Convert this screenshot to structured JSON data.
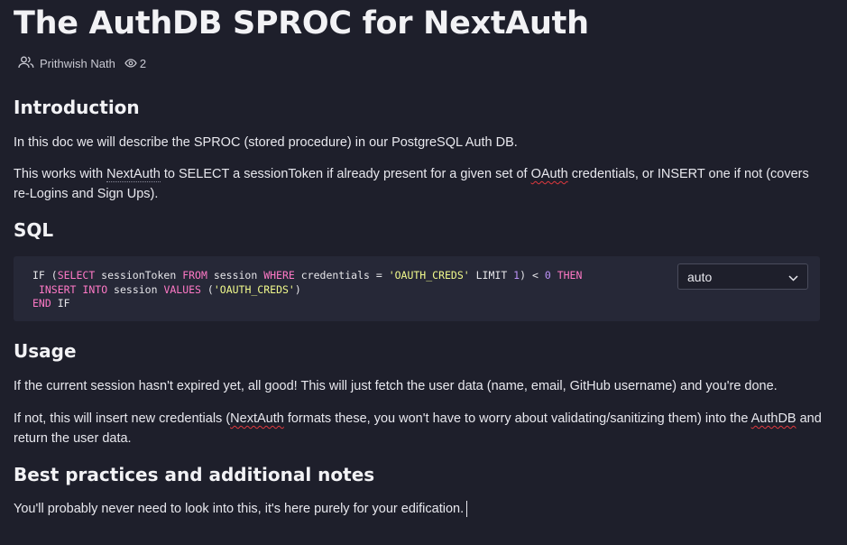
{
  "doc": {
    "title": "The AuthDB SPROC for NextAuth",
    "author": "Prithwish Nath",
    "views": "2"
  },
  "sections": {
    "intro_heading": "Introduction",
    "intro_p1": "In this doc we will describe the SPROC (stored procedure)  in our PostgreSQL Auth DB.",
    "intro_p2_a": "This works with ",
    "intro_p2_nextauth": "NextAuth",
    "intro_p2_b": " to SELECT a sessionToken if already present for a given set of ",
    "intro_p2_oauth": "OAuth",
    "intro_p2_c": " credentials, or INSERT one if not (covers re-Logins and Sign Ups).",
    "sql_heading": "SQL",
    "usage_heading": "Usage",
    "usage_p1": "If the current session hasn't expired yet, all good! This will just fetch the user data (name, email, GitHub username) and you're done.",
    "usage_p2_a": "If not, this will insert new credentials (",
    "usage_p2_nextauth": "NextAuth",
    "usage_p2_b": " formats these, you won't have to worry about validating/sanitizing them) into the ",
    "usage_p2_authdb": "AuthDB",
    "usage_p2_c": " and return the user data.",
    "best_heading": "Best practices and additional notes",
    "best_p1": "You'll probably never need to look into this, it's here purely for your edification."
  },
  "code": {
    "language": "auto",
    "line1": {
      "if": "IF (",
      "select": "SELECT",
      "t1": " sessionToken ",
      "from": "FROM",
      "t2": " session ",
      "where": "WHERE",
      "t3": " credentials = ",
      "s1": "'OAUTH_CREDS'",
      "t4": " LIMIT ",
      "n1": "1",
      "t5": ") < ",
      "n2": "0",
      "t6": " ",
      "then": "THEN"
    },
    "line2": {
      "insert": "INSERT",
      "t1": " ",
      "into": "INTO",
      "t2": " session ",
      "values": "VALUES",
      "t3": " (",
      "s1": "'OAUTH_CREDS'",
      "t4": ")"
    },
    "line3": {
      "end": "END",
      "t1": " IF"
    }
  },
  "icons": {
    "author": "users-icon",
    "views": "eye-icon"
  },
  "colors": {
    "background": "#1e1f2b",
    "code_background": "#262837",
    "keyword": "#ff79c6",
    "string": "#f1fa8c",
    "number": "#bd93f9"
  }
}
